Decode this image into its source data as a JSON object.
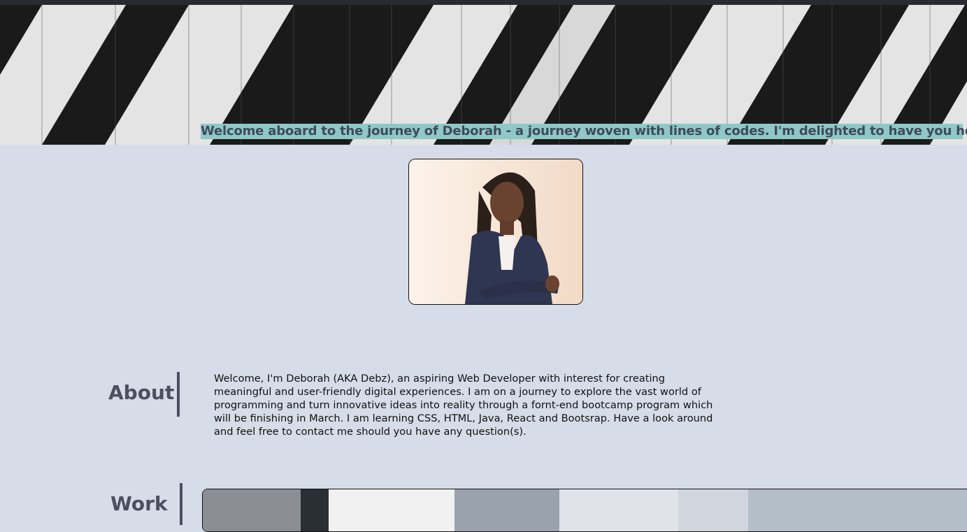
{
  "hero": {
    "welcome_text": "Welcome aboard to the journey of Deborah - a journey woven with lines of codes. I'm delighted to have you here."
  },
  "profile": {
    "alt": "Portrait of Deborah"
  },
  "about": {
    "heading": "About",
    "text": "Welcome, I'm Deborah (AKA Debz), an aspiring Web Developer with interest for creating meaningful and user-friendly digital experiences. I am on a journey to explore the vast world of programming and turn innovative ideas into reality through a fornt-end bootcamp program which will be finishing in March. I am learning CSS, HTML, Java, React and Bootsrap. Have a look around and feel free to contact me should you have any question(s)."
  },
  "work": {
    "heading": "Work"
  },
  "colors": {
    "page_bg": "#d6dce8",
    "banner_highlight": "#8fc8c6",
    "heading": "#4a5060"
  }
}
